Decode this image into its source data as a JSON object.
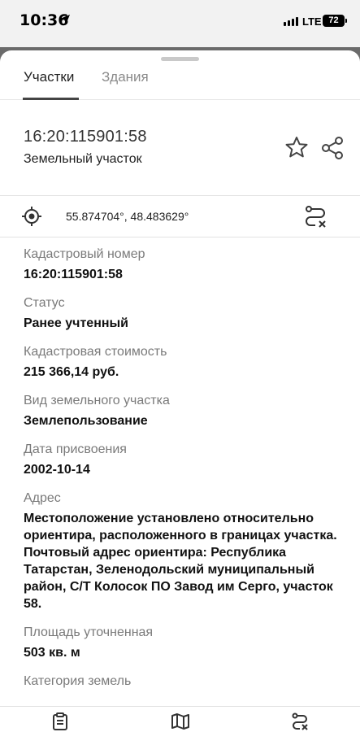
{
  "status_bar": {
    "time": "10:36",
    "network": "LTE",
    "battery": "72"
  },
  "tabs": [
    {
      "label": "Участки",
      "active": true
    },
    {
      "label": "Здания",
      "active": false
    }
  ],
  "object": {
    "cadastral_title": "16:20:115901:58",
    "type": "Земельный участок"
  },
  "coordinates": "55.874704°, 48.483629°",
  "fields": [
    {
      "label": "Кадастровый номер",
      "value": "16:20:115901:58"
    },
    {
      "label": "Статус",
      "value": "Ранее учтенный"
    },
    {
      "label": "Кадастровая стоимость",
      "value": "215 366,14 руб."
    },
    {
      "label": "Вид земельного участка",
      "value": "Землепользование"
    },
    {
      "label": "Дата присвоения",
      "value": "2002-10-14"
    },
    {
      "label": "Адрес",
      "value": "Местоположение установлено относительно ориентира, расположенного в границах участка. Почтовый адрес ориентира: Республика Татарстан, Зеленодольский муниципальный район, С/Т Колосок ПО Завод им Серго, участок 58."
    },
    {
      "label": "Площадь уточненная",
      "value": "503 кв. м"
    },
    {
      "label": "Категория земель",
      "value": ""
    }
  ],
  "icons": {
    "favorite": "star-icon",
    "share": "share-icon",
    "locate": "target-icon",
    "route": "route-clear-icon",
    "nav_details": "clipboard-icon",
    "nav_map": "map-icon",
    "nav_route": "route-clear-icon"
  },
  "colors": {
    "accent": "#444444",
    "label": "#7a7a7a"
  }
}
